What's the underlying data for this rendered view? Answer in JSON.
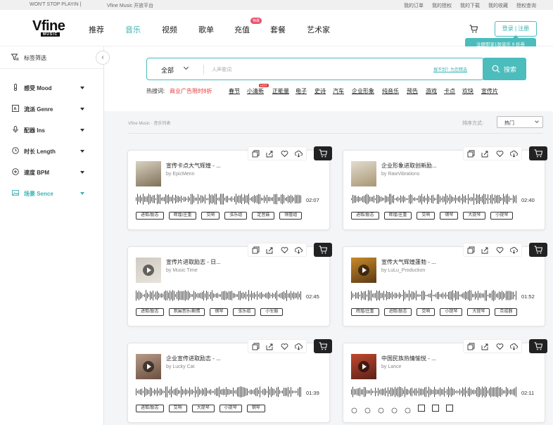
{
  "topbar": {
    "ticker": "WON'T STOP PLAYIN |",
    "platform": "Vfine Music 开放平台",
    "links": [
      "我的订单",
      "我的授权",
      "我的下载",
      "我的收藏",
      "授权查询"
    ]
  },
  "brand": {
    "logo_main": "Vfine",
    "logo_sub": "MUSIC"
  },
  "nav": {
    "items": [
      "推荐",
      "音乐",
      "视频",
      "歌单",
      "充值",
      "套餐",
      "艺术家"
    ],
    "active": "音乐",
    "recharge_badge": "特惠"
  },
  "account": {
    "login_label": "登录 | 注册",
    "promo_tip": "注册即享1张音乐 9 折券"
  },
  "sidebar": {
    "header": "标签筛选",
    "collapse_glyph": "‹",
    "items": [
      {
        "label": "感受 Mood",
        "icon": "thermometer-icon",
        "active": false
      },
      {
        "label": "流派 Genre",
        "icon": "genre-icon",
        "active": false
      },
      {
        "label": "配器 Ins",
        "icon": "microphone-icon",
        "active": false
      },
      {
        "label": "时长 Length",
        "icon": "clock-icon",
        "active": false
      },
      {
        "label": "速度 BPM",
        "icon": "speed-icon",
        "active": false
      },
      {
        "label": "场景 Sence",
        "icon": "scene-icon",
        "active": true
      }
    ]
  },
  "search": {
    "category": "全部",
    "placeholder": "人声歌词",
    "not_found_link": "搜不到？为您精选",
    "button_label": "搜索"
  },
  "hot_search": {
    "label": "热搜词:",
    "promo": "商业广告限时8折",
    "promo_badge": "HOT",
    "keywords": [
      "春节",
      "小清新",
      "正能量",
      "电子",
      "史诗",
      "汽车",
      "企业形象",
      "纯音乐",
      "预告",
      "游戏",
      "卡点",
      "欢快",
      "宣传片"
    ]
  },
  "listing": {
    "breadcrumb": "Vfine Music · 音乐列表",
    "sort_label": "排序方式:",
    "sort_value": "热门"
  },
  "tracks": [
    {
      "title": "宣传卡点大气辉煌 - ...",
      "author": "by EpicMenn",
      "duration": "02:07",
      "tags": [
        "进取/励志",
        "辉煌/庄重",
        "交响",
        "弦乐组",
        "定音鼓",
        "铜管组"
      ],
      "thumb_colors": [
        "#d9d2c2",
        "#7f6f57"
      ],
      "show_play": false
    },
    {
      "title": "企业形象进取创新励...",
      "author": "by RawVibrations",
      "duration": "02:40",
      "tags": [
        "进取/励志",
        "辉煌/庄重",
        "交响",
        "钢琴",
        "大提琴",
        "小提琴"
      ],
      "thumb_colors": [
        "#e2dccf",
        "#a99672"
      ],
      "show_play": false
    },
    {
      "title": "宣传片进取励志 - 日...",
      "author": "by Music Time",
      "duration": "02:45",
      "tags": [
        "进取/励志",
        "氛围音乐/剧情",
        "钢琴",
        "弦乐组",
        "小军鼓"
      ],
      "thumb_colors": [
        "#cfcac2",
        "#e8e4dc"
      ],
      "show_play": true
    },
    {
      "title": "宣传大气辉煌蓬勃 - ...",
      "author": "by LuLu_Production",
      "duration": "01:52",
      "tags": [
        "辉煌/庄重",
        "进取/励志",
        "交响",
        "小提琴",
        "大提琴",
        "合成器"
      ],
      "thumb_colors": [
        "#c98a2a",
        "#5b3a16"
      ],
      "show_play": true
    },
    {
      "title": "企业宣传进取励志 - ...",
      "author": "by Lucky Cat",
      "duration": "01:39",
      "tags": [
        "进取/励志",
        "交响",
        "大提琴",
        "小提琴",
        "钢琴"
      ],
      "thumb_colors": [
        "#b79a86",
        "#6a4f40"
      ],
      "show_play": true
    },
    {
      "title": "中国民族热情愉悦 - ...",
      "author": "by Lance",
      "duration": "02:11",
      "tags": [],
      "thumb_colors": [
        "#c0492f",
        "#5a2218"
      ],
      "show_play": true
    }
  ]
}
